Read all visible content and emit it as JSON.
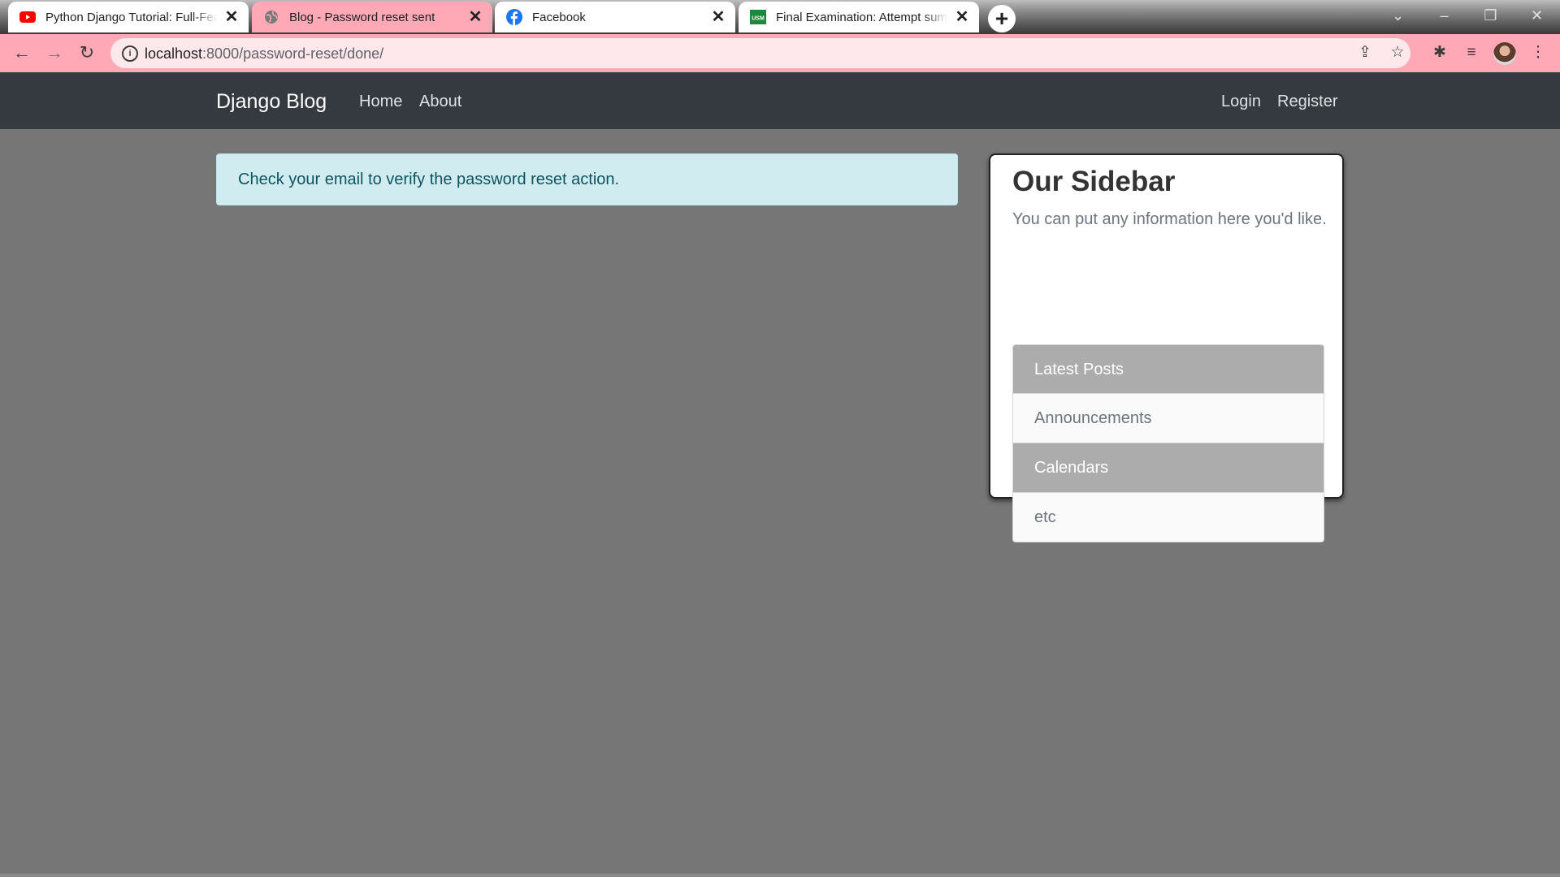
{
  "browser": {
    "tabs": [
      {
        "title": "Python Django Tutorial: Full-Featured Web App",
        "favicon": "youtube-icon",
        "active": false
      },
      {
        "title": "Blog - Password reset sent",
        "favicon": "globe-icon",
        "active": true
      },
      {
        "title": "Facebook",
        "favicon": "facebook-icon",
        "active": false
      },
      {
        "title": "Final Examination: Attempt summary",
        "favicon": "usm-icon",
        "active": false
      }
    ],
    "new_tab_symbol": "+",
    "close_symbol": "✕",
    "usm_badge": "USM",
    "url_host": "localhost",
    "url_path": ":8000/password-reset/done/",
    "accent_color": "#ffa8b6"
  },
  "site": {
    "brand": "Django Blog",
    "nav_left": [
      "Home",
      "About"
    ],
    "nav_right": [
      "Login",
      "Register"
    ]
  },
  "main": {
    "alert_text": "Check your email to verify the password reset action.",
    "alert_color": "#d1ecf1"
  },
  "sidebar": {
    "title": "Our Sidebar",
    "description": "You can put any information here you'd like.",
    "items": [
      "Latest Posts",
      "Announcements",
      "Calendars",
      "etc"
    ]
  }
}
